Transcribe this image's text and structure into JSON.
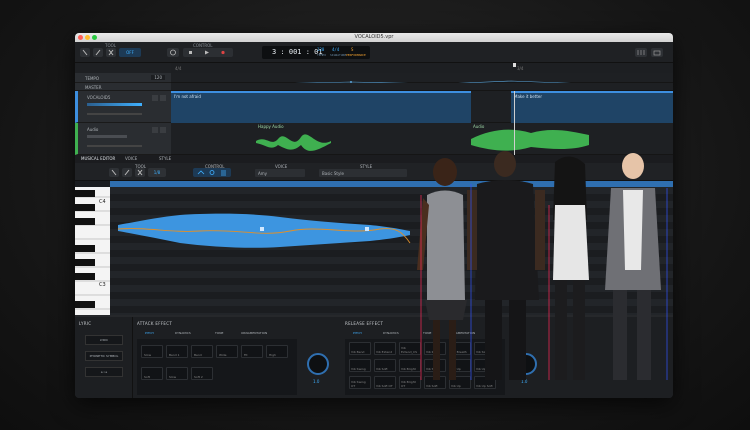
{
  "window": {
    "title": "VOCALOID5.vpr"
  },
  "toolbar": {
    "tool_label": "TOOL",
    "off_label": "OFF",
    "control_label": "CONTROL",
    "time": "3 : 001 : 01",
    "tempo_value": "120",
    "tempo_label": "TEMPO",
    "sig_value": "4/4",
    "sig_label": "SIGNATURE",
    "perf_label": "PERFORMANCE",
    "perf_indicator": "S"
  },
  "arrangement": {
    "marker_left": "4/4",
    "marker_right": "3/4",
    "tempo_label": "TEMPO",
    "tempo_value": "120",
    "master_label": "MASTER",
    "tracks": [
      {
        "name": "VOCALOID5",
        "color": "#3d8fe0",
        "part_label": "I'm not afraid",
        "part_label2": "Make it better"
      },
      {
        "name": "Audio",
        "color": "#3fb050",
        "part_label": "Happy Audio",
        "part_label2": "Audio"
      }
    ]
  },
  "editor_tabs": {
    "musical": "MUSICAL EDITOR",
    "voice": "VOICE",
    "style": "STYLE"
  },
  "editor_toolbar": {
    "tool_label": "TOOL",
    "grid_value": "1/8",
    "control_label": "CONTROL",
    "voice_label": "VOICE",
    "voice_value": "Amy",
    "style_label": "STYLE",
    "style_value": "Basic Style"
  },
  "piano": {
    "c4": "C4",
    "c3": "C3"
  },
  "bottom": {
    "lyric_title": "LYRIC",
    "lyric_btn1": "LYRIC",
    "lyric_btn2_label": "PHONETIC SYMBOL",
    "lyric_btn3": "a i e",
    "attack_title": "ATTACK EFFECT",
    "release_title": "RELEASE EFFECT",
    "attack_tabs": [
      "PITCH",
      "DYNAMICS",
      "TONE",
      "ORNAMENTATION"
    ],
    "release_tabs": [
      "PITCH",
      "DYNAMICS",
      "TONE",
      "ORNAMENTATION"
    ],
    "attack_cells_row1": [
      "Slow",
      "Bend 1",
      "Bend",
      "Wide",
      "Fit",
      "High"
    ],
    "attack_cells_row2": [
      "Soft",
      "Slow",
      "Soft 2"
    ],
    "release_cells_row1": [
      "Vib Bend",
      "Vib Extend",
      "Vib Extend_CS",
      "Vib Kyrie",
      "Vib Breath",
      "Vib Slow"
    ],
    "release_cells_row2": [
      "Vib Swing",
      "Vib Soft",
      "Vib Bright",
      "Vib Soft",
      "Vib Up",
      "Vib Up Soft"
    ],
    "release_cells_row3": [
      "Vib Swing OT",
      "Vib Soft OT",
      "Vib Bright OT",
      "Vib Soft",
      "Vib Up",
      "Vib Up Soft"
    ],
    "attack_knob_value": "1.0",
    "release_knob_value": "1.0"
  },
  "colors": {
    "accent_blue": "#3fb0ff",
    "vocal_track": "#3d8fe0",
    "audio_track": "#3fb050",
    "perf_orange": "#f0a030",
    "pitch_curve": "#e0902a"
  }
}
